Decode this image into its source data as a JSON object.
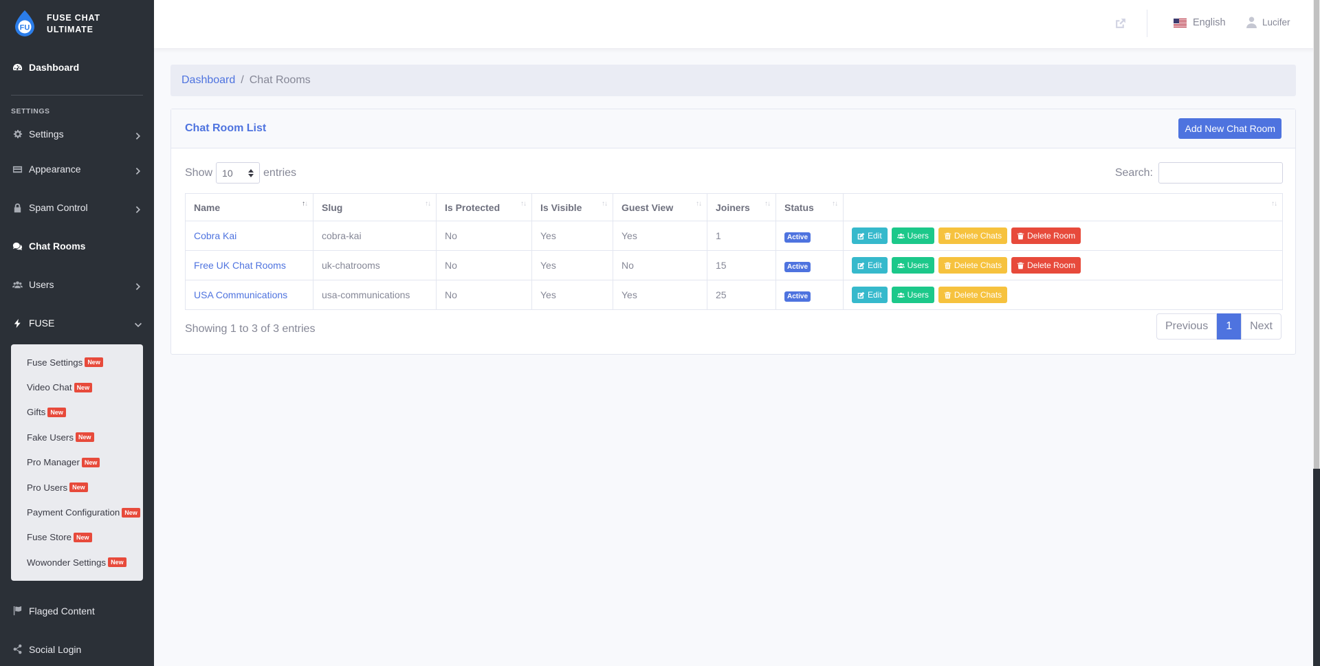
{
  "brand": {
    "line1": "FUSE CHAT",
    "line2": "ULTIMATE"
  },
  "sidebar": {
    "dashboard": "Dashboard",
    "heading": "SETTINGS",
    "items": [
      {
        "label": "Settings",
        "icon": "gear-icon"
      },
      {
        "label": "Appearance",
        "icon": "card-icon"
      },
      {
        "label": "Spam Control",
        "icon": "lock-icon"
      },
      {
        "label": "Chat Rooms",
        "icon": "comments-icon"
      },
      {
        "label": "Users",
        "icon": "users-icon"
      },
      {
        "label": "FUSE",
        "icon": "bolt-icon"
      }
    ],
    "fuse_submenu": [
      {
        "label": "Fuse Settings",
        "badge": "New"
      },
      {
        "label": "Video Chat",
        "badge": "New"
      },
      {
        "label": "Gifts",
        "badge": "New"
      },
      {
        "label": "Fake Users",
        "badge": "New"
      },
      {
        "label": "Pro Manager",
        "badge": "New"
      },
      {
        "label": "Pro Users",
        "badge": "New"
      },
      {
        "label": "Payment Configuration",
        "badge": "New"
      },
      {
        "label": "Fuse Store",
        "badge": "New"
      },
      {
        "label": "Wowonder Settings",
        "badge": "New"
      }
    ],
    "flagged": "Flaged Content",
    "social": "Social Login"
  },
  "topbar": {
    "language": "English",
    "user": "Lucifer"
  },
  "breadcrumb": {
    "home": "Dashboard",
    "separator": "/",
    "current": "Chat Rooms"
  },
  "card": {
    "title": "Chat Room List",
    "add_button": "Add New Chat Room",
    "show_label": "Show",
    "entries_value": "10",
    "entries_label": "entries",
    "search_label": "Search:",
    "columns": [
      "Name",
      "Slug",
      "Is Protected",
      "Is Visible",
      "Guest View",
      "Joiners",
      "Status",
      ""
    ],
    "rows": [
      {
        "name": "Cobra Kai",
        "slug": "cobra-kai",
        "protected": "No",
        "visible": "Yes",
        "guest": "Yes",
        "joiners": "1",
        "status": "Active"
      },
      {
        "name": "Free UK Chat Rooms",
        "slug": "uk-chatrooms",
        "protected": "No",
        "visible": "Yes",
        "guest": "No",
        "joiners": "15",
        "status": "Active"
      },
      {
        "name": "USA Communications",
        "slug": "usa-communications",
        "protected": "No",
        "visible": "Yes",
        "guest": "Yes",
        "joiners": "25",
        "status": "Active"
      }
    ],
    "actions": {
      "edit": "Edit",
      "users": "Users",
      "delete_chats": "Delete Chats",
      "delete_room": "Delete Room"
    },
    "info": "Showing 1 to 3 of 3 entries",
    "pagination": {
      "prev": "Previous",
      "current": "1",
      "next": "Next"
    }
  },
  "colors": {
    "primary": "#4e73df",
    "sidebar": "#2b3037",
    "info": "#36b9cc",
    "success": "#1cc88a",
    "warning": "#f6c23e",
    "danger": "#e74a3b"
  }
}
